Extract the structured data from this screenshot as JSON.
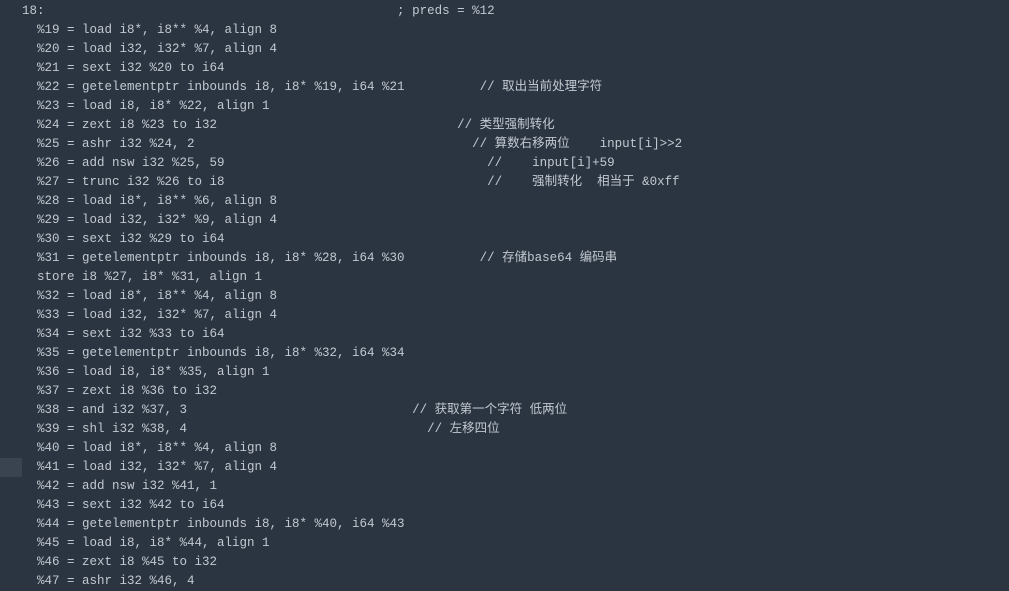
{
  "marked_line_index": 24,
  "lines": [
    "18:                                               ; preds = %12",
    "  %19 = load i8*, i8** %4, align 8",
    "  %20 = load i32, i32* %7, align 4",
    "  %21 = sext i32 %20 to i64",
    "  %22 = getelementptr inbounds i8, i8* %19, i64 %21          // 取出当前处理字符",
    "  %23 = load i8, i8* %22, align 1",
    "  %24 = zext i8 %23 to i32                                // 类型强制转化",
    "  %25 = ashr i32 %24, 2                                     // 算数右移两位    input[i]>>2",
    "  %26 = add nsw i32 %25, 59                                   //    input[i]+59",
    "  %27 = trunc i32 %26 to i8                                   //    强制转化  相当于 &0xff",
    "  %28 = load i8*, i8** %6, align 8",
    "  %29 = load i32, i32* %9, align 4",
    "  %30 = sext i32 %29 to i64",
    "  %31 = getelementptr inbounds i8, i8* %28, i64 %30          // 存储base64 编码串",
    "  store i8 %27, i8* %31, align 1",
    "  %32 = load i8*, i8** %4, align 8",
    "  %33 = load i32, i32* %7, align 4",
    "  %34 = sext i32 %33 to i64",
    "  %35 = getelementptr inbounds i8, i8* %32, i64 %34",
    "  %36 = load i8, i8* %35, align 1",
    "  %37 = zext i8 %36 to i32",
    "  %38 = and i32 %37, 3                              // 获取第一个字符 低两位",
    "  %39 = shl i32 %38, 4                                // 左移四位",
    "  %40 = load i8*, i8** %4, align 8",
    "  %41 = load i32, i32* %7, align 4",
    "  %42 = add nsw i32 %41, 1",
    "  %43 = sext i32 %42 to i64",
    "  %44 = getelementptr inbounds i8, i8* %40, i64 %43",
    "  %45 = load i8, i8* %44, align 1",
    "  %46 = zext i8 %45 to i32",
    "  %47 = ashr i32 %46, 4"
  ]
}
